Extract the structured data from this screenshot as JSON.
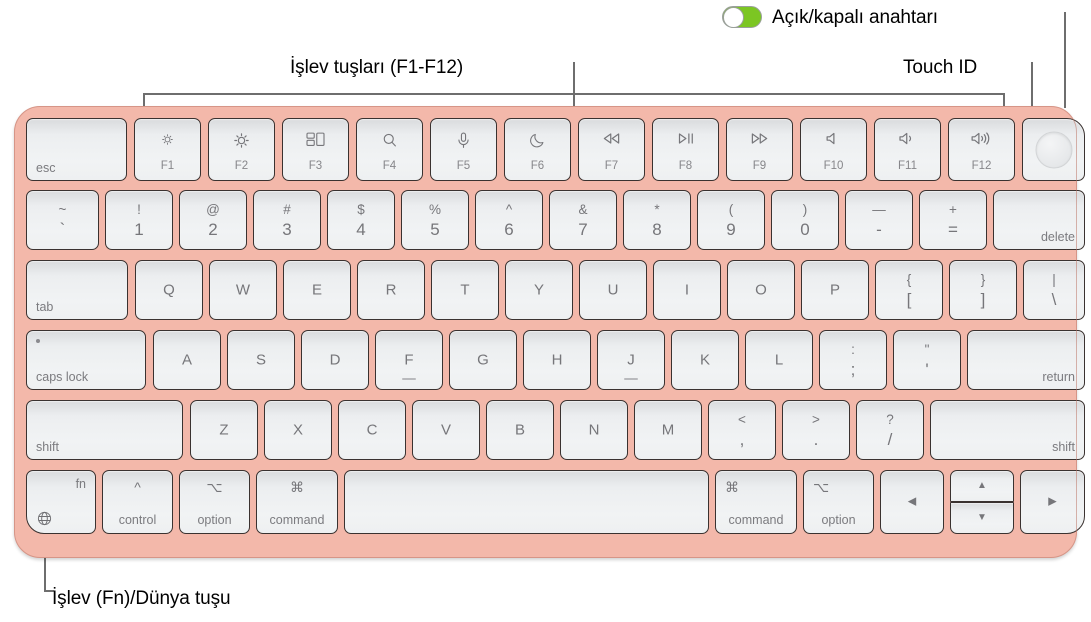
{
  "callouts": {
    "power_switch": "Açık/kapalı anahtarı",
    "function_keys": "İşlev tuşları (F1-F12)",
    "touch_id": "Touch ID",
    "fn_globe": "İşlev (Fn)/Dünya tuşu"
  },
  "colors": {
    "chassis": "#f3b8aa",
    "key_face": "#eef0f1",
    "key_border": "#3a3230",
    "key_text": "#76767a",
    "toggle_on": "#7cc623",
    "leader_line": "#6e6e6e"
  },
  "toggle": {
    "state": "on",
    "knob_side": "left"
  },
  "keyboard": {
    "rows": [
      {
        "name": "function-row",
        "keys": [
          {
            "name": "esc",
            "corner": "esc"
          },
          {
            "name": "f1",
            "icon": "brightness-down-icon",
            "flabel": "F1"
          },
          {
            "name": "f2",
            "icon": "brightness-up-icon",
            "flabel": "F2"
          },
          {
            "name": "f3",
            "icon": "mission-control-icon",
            "flabel": "F3"
          },
          {
            "name": "f4",
            "icon": "spotlight-search-icon",
            "flabel": "F4"
          },
          {
            "name": "f5",
            "icon": "microphone-icon",
            "flabel": "F5"
          },
          {
            "name": "f6",
            "icon": "do-not-disturb-moon-icon",
            "flabel": "F6"
          },
          {
            "name": "f7",
            "icon": "rewind-icon",
            "flabel": "F7"
          },
          {
            "name": "f8",
            "icon": "play-pause-icon",
            "flabel": "F8"
          },
          {
            "name": "f9",
            "icon": "fast-forward-icon",
            "flabel": "F9"
          },
          {
            "name": "f10",
            "icon": "volume-mute-icon",
            "flabel": "F10"
          },
          {
            "name": "f11",
            "icon": "volume-down-icon",
            "flabel": "F11"
          },
          {
            "name": "f12",
            "icon": "volume-up-icon",
            "flabel": "F12"
          },
          {
            "name": "touch-id",
            "icon": "touch-id-icon"
          }
        ]
      },
      {
        "name": "number-row",
        "keys": [
          {
            "name": "grave-tilde",
            "up": "~",
            "low": "`"
          },
          {
            "name": "digit-1",
            "up": "!",
            "low": "1"
          },
          {
            "name": "digit-2",
            "up": "@",
            "low": "2"
          },
          {
            "name": "digit-3",
            "up": "#",
            "low": "3"
          },
          {
            "name": "digit-4",
            "up": "$",
            "low": "4"
          },
          {
            "name": "digit-5",
            "up": "%",
            "low": "5"
          },
          {
            "name": "digit-6",
            "up": "^",
            "low": "6"
          },
          {
            "name": "digit-7",
            "up": "&",
            "low": "7"
          },
          {
            "name": "digit-8",
            "up": "*",
            "low": "8"
          },
          {
            "name": "digit-9",
            "up": "(",
            "low": "9"
          },
          {
            "name": "digit-0",
            "up": ")",
            "low": "0"
          },
          {
            "name": "minus-underscore",
            "up": "—",
            "low": "-"
          },
          {
            "name": "equals-plus",
            "up": "+",
            "low": "="
          },
          {
            "name": "delete",
            "corner": "delete"
          }
        ]
      },
      {
        "name": "qwerty-row",
        "keys": [
          {
            "name": "tab",
            "corner": "tab"
          },
          {
            "name": "letter-q",
            "single": "Q"
          },
          {
            "name": "letter-w",
            "single": "W"
          },
          {
            "name": "letter-e",
            "single": "E"
          },
          {
            "name": "letter-r",
            "single": "R"
          },
          {
            "name": "letter-t",
            "single": "T"
          },
          {
            "name": "letter-y",
            "single": "Y"
          },
          {
            "name": "letter-u",
            "single": "U"
          },
          {
            "name": "letter-i",
            "single": "I"
          },
          {
            "name": "letter-o",
            "single": "O"
          },
          {
            "name": "letter-p",
            "single": "P"
          },
          {
            "name": "bracket-left",
            "up": "{",
            "low": "["
          },
          {
            "name": "bracket-right",
            "up": "}",
            "low": "]"
          },
          {
            "name": "backslash-pipe",
            "up": "|",
            "low": "\\"
          }
        ]
      },
      {
        "name": "home-row",
        "keys": [
          {
            "name": "caps-lock",
            "corner": "caps lock"
          },
          {
            "name": "letter-a",
            "single": "A"
          },
          {
            "name": "letter-s",
            "single": "S"
          },
          {
            "name": "letter-d",
            "single": "D"
          },
          {
            "name": "letter-f",
            "single": "F"
          },
          {
            "name": "letter-g",
            "single": "G"
          },
          {
            "name": "letter-h",
            "single": "H"
          },
          {
            "name": "letter-j",
            "single": "J"
          },
          {
            "name": "letter-k",
            "single": "K"
          },
          {
            "name": "letter-l",
            "single": "L"
          },
          {
            "name": "semicolon-colon",
            "up": ":",
            "low": ";"
          },
          {
            "name": "quote-apostrophe",
            "up": "\"",
            "low": "'"
          },
          {
            "name": "return",
            "corner": "return"
          }
        ]
      },
      {
        "name": "shift-row",
        "keys": [
          {
            "name": "shift-left",
            "corner": "shift"
          },
          {
            "name": "letter-z",
            "single": "Z"
          },
          {
            "name": "letter-x",
            "single": "X"
          },
          {
            "name": "letter-c",
            "single": "C"
          },
          {
            "name": "letter-v",
            "single": "V"
          },
          {
            "name": "letter-b",
            "single": "B"
          },
          {
            "name": "letter-n",
            "single": "N"
          },
          {
            "name": "letter-m",
            "single": "M"
          },
          {
            "name": "comma-less",
            "up": "<",
            "low": ","
          },
          {
            "name": "period-greater",
            "up": ">",
            "low": "."
          },
          {
            "name": "slash-question",
            "up": "?",
            "low": "/"
          },
          {
            "name": "shift-right",
            "corner": "shift"
          }
        ]
      },
      {
        "name": "modifier-row",
        "keys": [
          {
            "name": "fn-globe",
            "fnword": "fn",
            "icon": "globe-icon"
          },
          {
            "name": "control-left",
            "glyph": "^",
            "word": "control"
          },
          {
            "name": "option-left",
            "glyph": "⌥",
            "word": "option"
          },
          {
            "name": "command-left",
            "glyph": "⌘",
            "word": "command"
          },
          {
            "name": "space"
          },
          {
            "name": "command-right",
            "glyph": "⌘",
            "word": "command"
          },
          {
            "name": "option-right",
            "glyph": "⌥",
            "word": "option"
          },
          {
            "name": "arrow-left",
            "single": "◀"
          },
          {
            "name": "arrow-up",
            "single": "▲"
          },
          {
            "name": "arrow-down",
            "single": "▼"
          },
          {
            "name": "arrow-right",
            "single": "▶"
          }
        ]
      }
    ]
  }
}
